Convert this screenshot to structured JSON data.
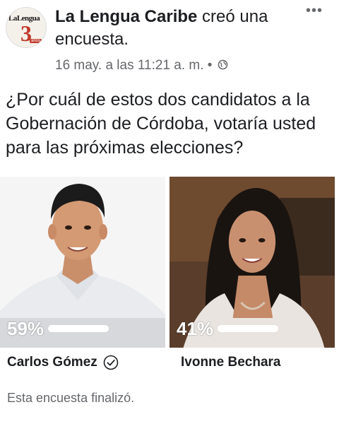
{
  "post": {
    "page_name": "La Lengua Caribe",
    "action": " creó una encuesta.",
    "timestamp": "16 may. a las 11:21 a. m. •",
    "privacy_icon": "globe-icon",
    "more_icon": "more-options-icon",
    "avatar": {
      "logo_text": "LaLengua",
      "logo_number": "3",
      "logo_sub": "años"
    }
  },
  "poll": {
    "question": "¿Por cuál de estos dos candidatos a la Gobernación de Córdoba, votaría usted para las próximas elecciones?",
    "options": [
      {
        "name": "Carlos Gómez",
        "percent_label": "59%",
        "share": 0.59,
        "selected": true
      },
      {
        "name": "Ivonne Bechara",
        "percent_label": "41%",
        "share": 0.41,
        "selected": false
      }
    ],
    "status": "Esta encuesta finalizó."
  },
  "colors": {
    "text": "#1c1e21",
    "muted": "#65676b",
    "brand_red": "#c0392b"
  }
}
